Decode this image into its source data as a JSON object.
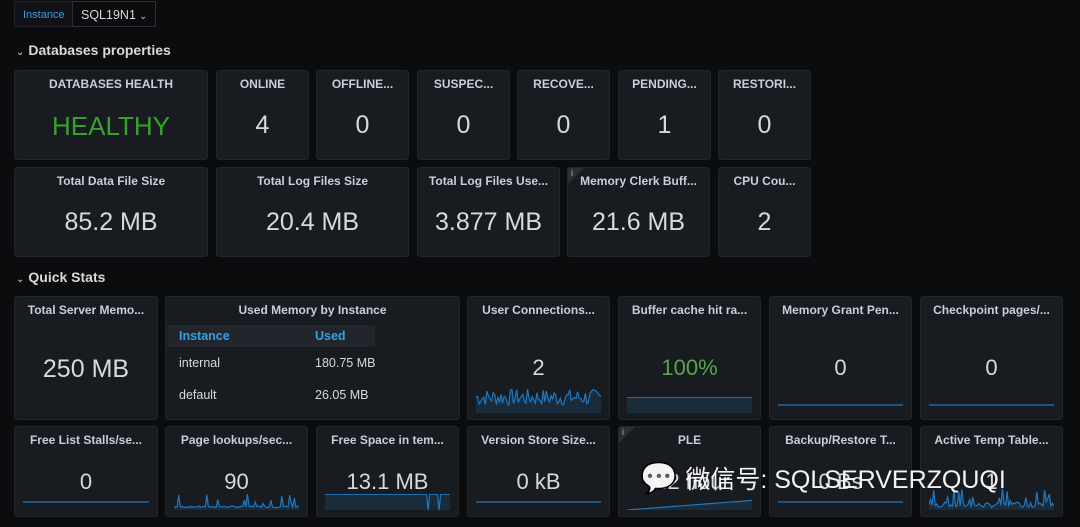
{
  "variables": {
    "label": "Instance",
    "value": "SQL19N1"
  },
  "sections": {
    "db": "Databases properties",
    "quick": "Quick Stats"
  },
  "row1": [
    {
      "title": "DATABASES HEALTH",
      "value": "HEALTHY",
      "color": "#37a22b"
    },
    {
      "title": "ONLINE",
      "value": "4"
    },
    {
      "title": "OFFLINE...",
      "value": "0"
    },
    {
      "title": "SUSPEC...",
      "value": "0"
    },
    {
      "title": "RECOVE...",
      "value": "0"
    },
    {
      "title": "PENDING...",
      "value": "1"
    },
    {
      "title": "RESTORI...",
      "value": "0"
    }
  ],
  "row2": [
    {
      "title": "Total Data File Size",
      "value": "85.2 MB"
    },
    {
      "title": "Total Log Files Size",
      "value": "20.4 MB"
    },
    {
      "title": "Total Log Files Use...",
      "value": "3.877 MB"
    },
    {
      "title": "Memory Clerk Buff...",
      "value": "21.6 MB",
      "info": "i"
    },
    {
      "title": "CPU Cou...",
      "value": "2"
    }
  ],
  "row3": {
    "total_mem": {
      "title": "Total Server Memo...",
      "value": "250 MB"
    },
    "used_mem": {
      "title": "Used Memory by Instance",
      "columns": [
        "Instance",
        "Used"
      ],
      "rows": [
        [
          "internal",
          "180.75 MB"
        ],
        [
          "default",
          "26.05 MB"
        ]
      ]
    },
    "panels": [
      {
        "title": "User Connections...",
        "value": "2",
        "spark": "noisy"
      },
      {
        "title": "Buffer cache hit ra...",
        "value": "100%",
        "color": "#56a64b",
        "spark": "filled"
      },
      {
        "title": "Memory Grant Pen...",
        "value": "0",
        "spark": "flat"
      },
      {
        "title": "Checkpoint pages/...",
        "value": "0",
        "spark": "flat"
      }
    ]
  },
  "row4": [
    {
      "title": "Free List Stalls/se...",
      "value": "0",
      "spark": "flat"
    },
    {
      "title": "Page lookups/sec...",
      "value": "90",
      "spark": "spiky"
    },
    {
      "title": "Free Space in tem...",
      "value": "13.1 MB",
      "spark": "filled-dips"
    },
    {
      "title": "Version Store Size...",
      "value": "0 kB",
      "spark": "flat"
    },
    {
      "title": "PLE",
      "value": "3.2 hour",
      "info": "i",
      "spark": "rising"
    },
    {
      "title": "Backup/Restore T...",
      "value": "0 Bs",
      "spark": "flat"
    },
    {
      "title": "Active Temp Table...",
      "value": "1",
      "spark": "noisy-small"
    }
  ],
  "watermark": "微信号: SQLSERVERZQUQI",
  "colors": {
    "accent": "#33a2e5",
    "spark": "#1f78c1",
    "healthy": "#37a22b"
  }
}
